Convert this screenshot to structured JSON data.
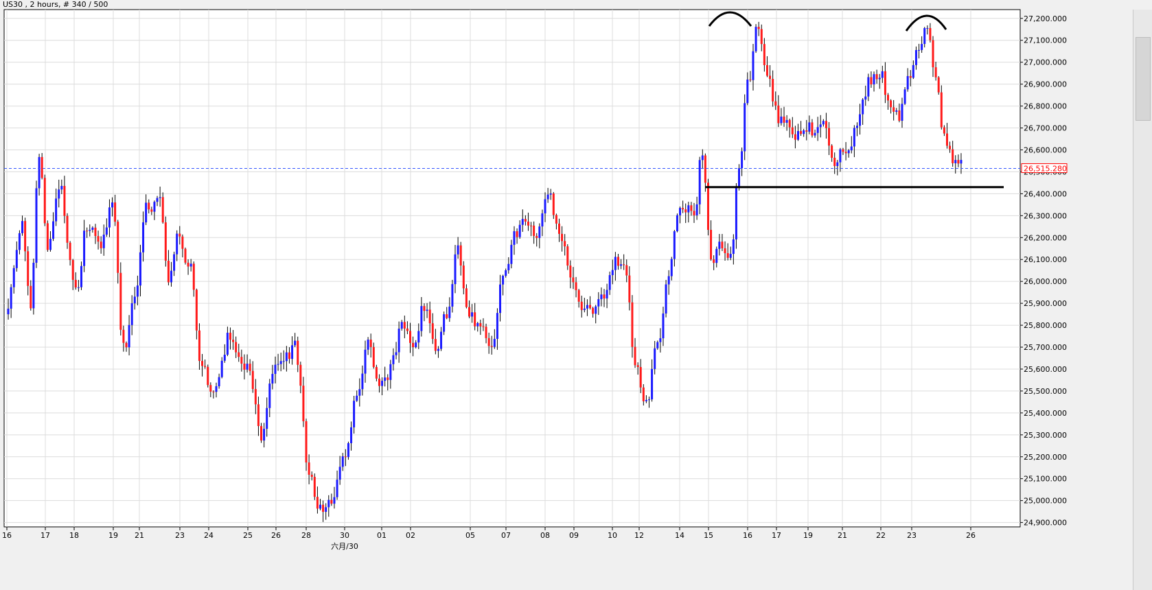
{
  "header": {
    "title": "US30 , 2 hours, # 340 / 500"
  },
  "colors": {
    "up": "#1a1aff",
    "down": "#ff1a1a",
    "grid": "#dcdcdc",
    "price_line": "#3355ff",
    "price_label": "#ff0000",
    "annotation": "#000000"
  },
  "chart_data": {
    "type": "candlestick",
    "symbol": "US30",
    "timeframe": "2 hours",
    "ylim": [
      24880,
      27240
    ],
    "y_ticks": [
      "27,200.000",
      "27,100.000",
      "27,000.000",
      "26,900.000",
      "26,800.000",
      "26,700.000",
      "26,600.000",
      "26,500.000",
      "26,400.000",
      "26,300.000",
      "26,200.000",
      "26,100.000",
      "26,000.000",
      "25,900.000",
      "25,800.000",
      "25,700.000",
      "25,600.000",
      "25,500.000",
      "25,400.000",
      "25,300.000",
      "25,200.000",
      "25,100.000",
      "25,000.000",
      "24,900.000"
    ],
    "x_ticks": [
      "16",
      "17",
      "18",
      "19",
      "21",
      "23",
      "24",
      "25",
      "26",
      "28",
      "30",
      "01",
      "02",
      "05",
      "07",
      "08",
      "09",
      "10",
      "12",
      "14",
      "15",
      "16",
      "17",
      "19",
      "21",
      "22",
      "23",
      "26"
    ],
    "x_sublabel": "六月/30",
    "current_price": 26515.28,
    "current_price_label": "26,515.280",
    "candles_count": 340,
    "anchors": [
      [
        0,
        25850
      ],
      [
        6,
        26250
      ],
      [
        9,
        25900
      ],
      [
        12,
        26600
      ],
      [
        15,
        26150
      ],
      [
        19,
        26450
      ],
      [
        25,
        25950
      ],
      [
        29,
        26250
      ],
      [
        34,
        26150
      ],
      [
        38,
        26350
      ],
      [
        42,
        25700
      ],
      [
        46,
        25900
      ],
      [
        50,
        26350
      ],
      [
        55,
        26350
      ],
      [
        58,
        26000
      ],
      [
        61,
        26200
      ],
      [
        66,
        26050
      ],
      [
        69,
        25650
      ],
      [
        74,
        25500
      ],
      [
        80,
        25750
      ],
      [
        86,
        25600
      ],
      [
        91,
        25300
      ],
      [
        95,
        25600
      ],
      [
        99,
        25650
      ],
      [
        103,
        25700
      ],
      [
        108,
        25150
      ],
      [
        112,
        24950
      ],
      [
        116,
        25000
      ],
      [
        121,
        25200
      ],
      [
        125,
        25500
      ],
      [
        129,
        25700
      ],
      [
        133,
        25500
      ],
      [
        137,
        25600
      ],
      [
        141,
        25800
      ],
      [
        145,
        25700
      ],
      [
        149,
        25900
      ],
      [
        153,
        25700
      ],
      [
        157,
        25850
      ],
      [
        161,
        26150
      ],
      [
        165,
        25850
      ],
      [
        169,
        25800
      ],
      [
        173,
        25700
      ],
      [
        177,
        26000
      ],
      [
        181,
        26200
      ],
      [
        185,
        26300
      ],
      [
        189,
        26200
      ],
      [
        193,
        26400
      ],
      [
        197,
        26200
      ],
      [
        201,
        26050
      ],
      [
        205,
        25900
      ],
      [
        209,
        25850
      ],
      [
        213,
        25950
      ],
      [
        217,
        26100
      ],
      [
        221,
        26050
      ],
      [
        224,
        25600
      ],
      [
        228,
        25450
      ],
      [
        232,
        25700
      ],
      [
        236,
        26050
      ],
      [
        240,
        26350
      ],
      [
        245,
        26300
      ],
      [
        248,
        26600
      ],
      [
        251,
        26100
      ],
      [
        254,
        26150
      ],
      [
        258,
        26100
      ],
      [
        261,
        26500
      ],
      [
        264,
        26900
      ],
      [
        268,
        27170
      ],
      [
        271,
        26950
      ],
      [
        275,
        26750
      ],
      [
        279,
        26700
      ],
      [
        283,
        26650
      ],
      [
        287,
        26700
      ],
      [
        291,
        26750
      ],
      [
        295,
        26550
      ],
      [
        299,
        26600
      ],
      [
        303,
        26700
      ],
      [
        307,
        26900
      ],
      [
        311,
        26950
      ],
      [
        315,
        26800
      ],
      [
        318,
        26750
      ],
      [
        322,
        26950
      ],
      [
        326,
        27100
      ],
      [
        328,
        27150
      ],
      [
        331,
        26900
      ],
      [
        334,
        26650
      ],
      [
        337,
        26550
      ],
      [
        340,
        26520
      ]
    ]
  },
  "annotations": [
    {
      "type": "arc",
      "label": "left-shoulder-arc"
    },
    {
      "type": "arc",
      "label": "right-shoulder-arc"
    },
    {
      "type": "horizontal-line",
      "label": "neckline",
      "price": 26430
    }
  ]
}
